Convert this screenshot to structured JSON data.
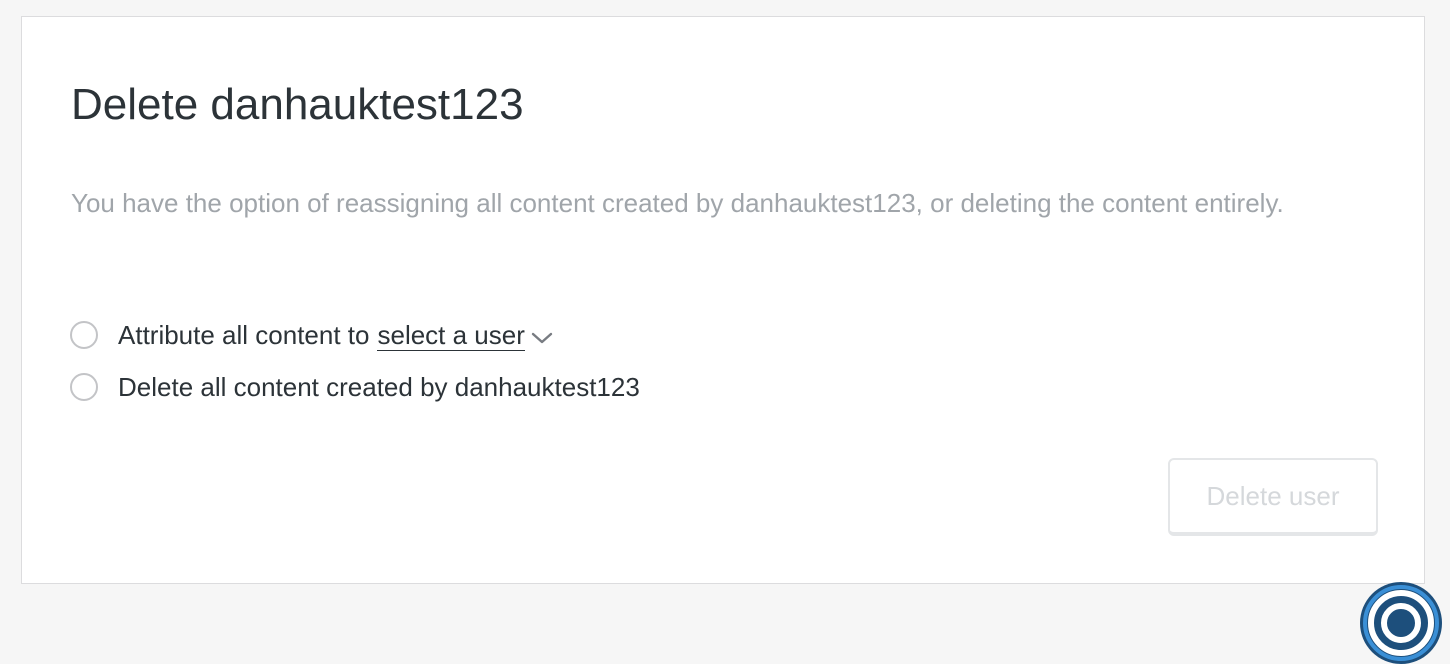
{
  "dialog": {
    "title": "Delete danhauktest123",
    "description": "You have the option of reassigning all content created by danhauktest123, or deleting the content entirely.",
    "options": [
      {
        "label": "Attribute all content to",
        "select_value": "select a user",
        "selected": false
      },
      {
        "label": "Delete all content created by danhauktest123",
        "selected": false
      }
    ],
    "delete_button_label": "Delete user",
    "delete_button_disabled": true
  },
  "help_button": {
    "icon": "help-icon",
    "color": "#1d4f7c"
  },
  "colors": {
    "title_text": "#2c3338",
    "muted_text": "#a0a5aa",
    "border": "#dcdcde",
    "page_background": "#f6f6f6"
  }
}
